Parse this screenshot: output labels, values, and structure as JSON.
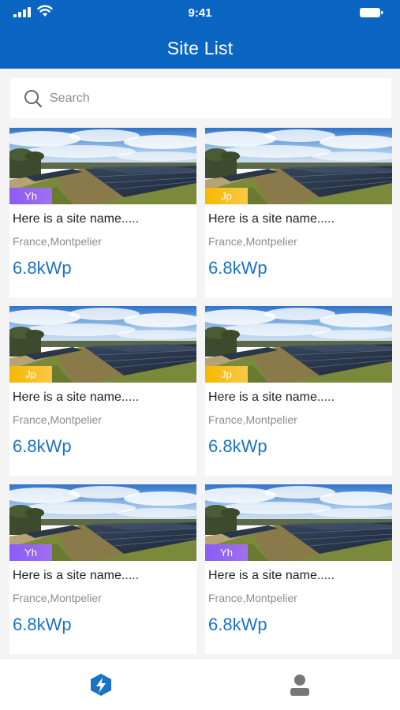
{
  "status_bar": {
    "time": "9:41"
  },
  "header": {
    "title": "Site List"
  },
  "search": {
    "placeholder": "Search"
  },
  "sites": [
    {
      "name": "Here is a site name.....",
      "location": "France,Montpelier",
      "power": "6.8kWp",
      "badge": "Yh",
      "badge_color": "#8b5cf6"
    },
    {
      "name": "Here is a site name.....",
      "location": "France,Montpelier",
      "power": "6.8kWp",
      "badge": "Jp",
      "badge_color": "#f6b800"
    },
    {
      "name": "Here is a site name.....",
      "location": "France,Montpelier",
      "power": "6.8kWp",
      "badge": "Jp",
      "badge_color": "#f6b800"
    },
    {
      "name": "Here is a site name.....",
      "location": "France,Montpelier",
      "power": "6.8kWp",
      "badge": "Jp",
      "badge_color": "#f6b800"
    },
    {
      "name": "Here is a site name.....",
      "location": "France,Montpelier",
      "power": "6.8kWp",
      "badge": "Yh",
      "badge_color": "#8b5cf6"
    },
    {
      "name": "Here is a site name.....",
      "location": "France,Montpelier",
      "power": "6.8kWp",
      "badge": "Yh",
      "badge_color": "#8b5cf6"
    }
  ],
  "tab_bar": {
    "items": [
      {
        "icon": "power-station-icon",
        "active": true
      },
      {
        "icon": "profile-icon",
        "active": false
      }
    ]
  },
  "colors": {
    "header": "#0a66c2",
    "accent": "#1a73c9",
    "badge_purple": "#8b5cf6",
    "badge_yellow": "#f6b800"
  }
}
